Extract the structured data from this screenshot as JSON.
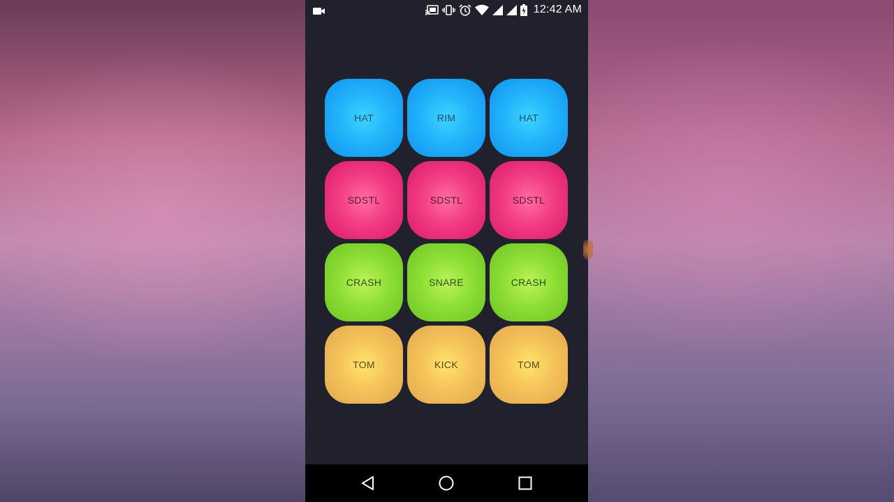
{
  "status_bar": {
    "time": "12:42 AM",
    "icons": [
      "video-camera-icon",
      "cast-icon",
      "vibrate-icon",
      "alarm-icon",
      "wifi-icon",
      "signal-icon",
      "battery-charging-icon"
    ]
  },
  "pads": [
    {
      "label": "HAT",
      "color": "blue"
    },
    {
      "label": "RIM",
      "color": "blue"
    },
    {
      "label": "HAT",
      "color": "blue"
    },
    {
      "label": "SDSTL",
      "color": "pink"
    },
    {
      "label": "SDSTL",
      "color": "pink"
    },
    {
      "label": "SDSTL",
      "color": "pink"
    },
    {
      "label": "CRASH",
      "color": "green"
    },
    {
      "label": "SNARE",
      "color": "green"
    },
    {
      "label": "CRASH",
      "color": "green"
    },
    {
      "label": "TOM",
      "color": "orange"
    },
    {
      "label": "KICK",
      "color": "orange"
    },
    {
      "label": "TOM",
      "color": "orange"
    }
  ],
  "colors": {
    "blue": "#22b4fb",
    "pink": "#f23d83",
    "green": "#8fdf35",
    "orange": "#f5c35a",
    "app_background": "#20212c"
  },
  "nav_bar": {
    "icons": [
      "back-icon",
      "home-icon",
      "recent-apps-icon"
    ]
  }
}
